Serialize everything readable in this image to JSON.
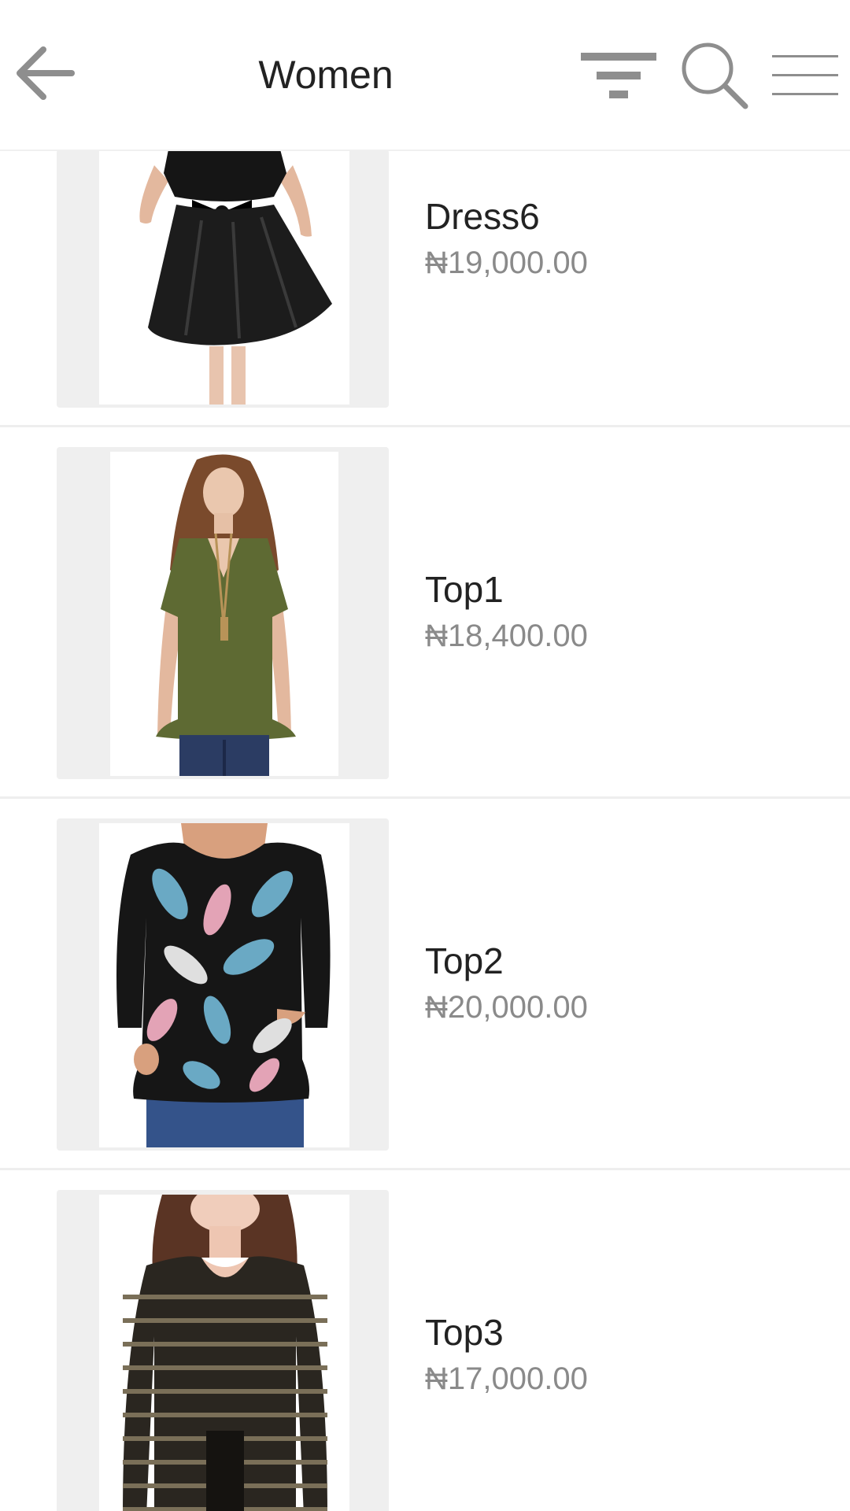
{
  "header": {
    "title": "Women",
    "back_icon": "arrow-left-icon",
    "filter_icon": "filter-icon",
    "search_icon": "search-icon",
    "menu_icon": "hamburger-menu-icon"
  },
  "colors": {
    "title_text": "#222222",
    "price_text": "#8a8a8a",
    "icon_gray": "#8e8e8e",
    "thumb_bg": "#efefef",
    "divider": "#eeeeee"
  },
  "products": [
    {
      "name": "Dress6",
      "price": "₦19,000.00"
    },
    {
      "name": "Top1",
      "price": "₦18,400.00"
    },
    {
      "name": "Top2",
      "price": "₦20,000.00"
    },
    {
      "name": "Top3",
      "price": "₦17,000.00"
    }
  ]
}
